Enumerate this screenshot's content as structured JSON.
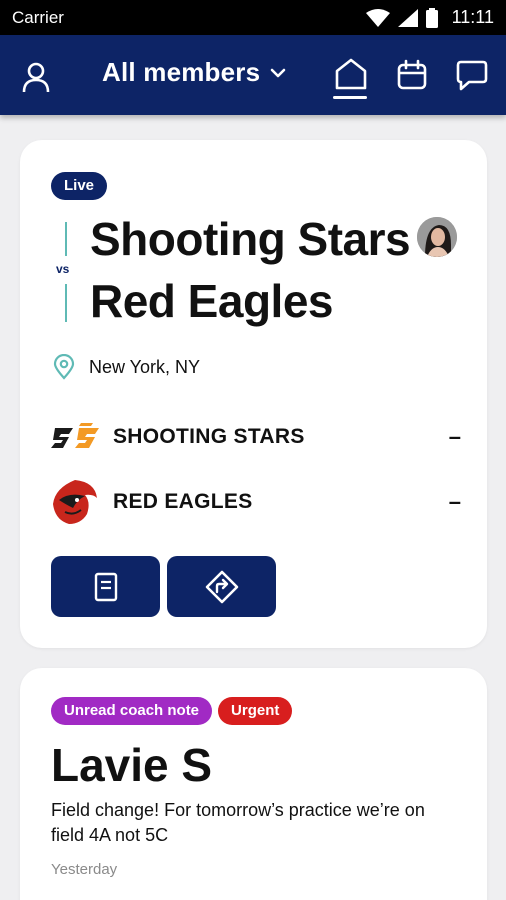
{
  "status_bar": {
    "carrier": "Carrier",
    "time": "11:11"
  },
  "app_bar": {
    "title": "All members",
    "icons": [
      "profile-icon",
      "chevron-down-icon",
      "home-icon",
      "calendar-icon",
      "chat-icon"
    ]
  },
  "game": {
    "status_badge": "Live",
    "vs_label": "vs",
    "home_team": "Shooting Stars",
    "away_team": "Red Eagles",
    "location": "New York, NY",
    "scores": [
      {
        "team": "SHOOTING STARS",
        "score": "–"
      },
      {
        "team": "RED EAGLES",
        "score": "–"
      }
    ],
    "accent_color": "#0d2466",
    "vs_line_color": "#5fbab5"
  },
  "note": {
    "badges": [
      "Unread coach note",
      "Urgent"
    ],
    "author": "Lavie S",
    "message": "Field change! For tomorrow’s practice we’re on field 4A not 5C",
    "time": "Yesterday",
    "badge_colors": {
      "unread": "#a12ac4",
      "urgent": "#d81e1e"
    }
  }
}
